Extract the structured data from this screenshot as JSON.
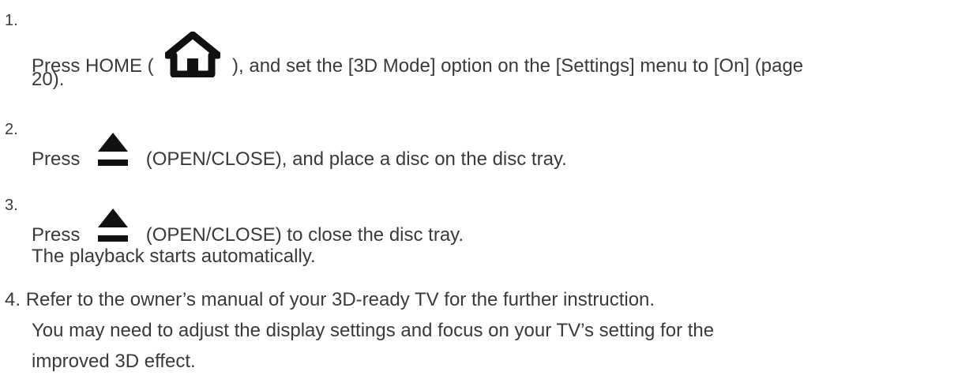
{
  "steps": [
    {
      "number": "1.",
      "lines": [
        "Press HOME (",
        "), and set the [3D Mode] option on the [Settings] menu to [On] (page",
        "20)."
      ],
      "icon": "home-icon"
    },
    {
      "number": "2.",
      "lines": [
        "Press",
        "(OPEN/CLOSE), and place a disc on the disc tray."
      ],
      "icon": "eject-icon"
    },
    {
      "number": "3.",
      "lines": [
        "Press",
        "(OPEN/CLOSE) to close the disc tray.",
        "The playback starts automatically."
      ],
      "icon": "eject-icon"
    },
    {
      "number": "4.",
      "lines": [
        "Refer to the owner’s manual of your 3D-ready TV for the further instruction.",
        "You may need to adjust the display settings and focus on your TV’s setting for the",
        "improved 3D effect."
      ]
    }
  ],
  "colors": {
    "text": "#3a3a3a",
    "icon": "#111111"
  }
}
